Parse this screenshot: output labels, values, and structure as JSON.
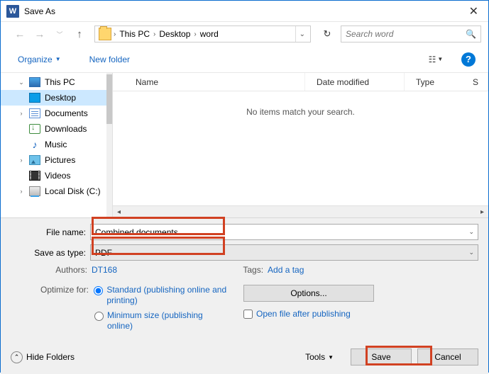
{
  "window": {
    "title": "Save As"
  },
  "path": {
    "root": "This PC",
    "p1": "Desktop",
    "p2": "word"
  },
  "search": {
    "placeholder": "Search word"
  },
  "toolbar": {
    "organize": "Organize",
    "newfolder": "New folder"
  },
  "tree": {
    "pc": "This PC",
    "desktop": "Desktop",
    "documents": "Documents",
    "downloads": "Downloads",
    "music": "Music",
    "pictures": "Pictures",
    "videos": "Videos",
    "localdisk": "Local Disk (C:)"
  },
  "cols": {
    "name": "Name",
    "date": "Date modified",
    "type": "Type",
    "size": "S"
  },
  "empty": "No items match your search.",
  "form": {
    "fname_label": "File name:",
    "fname_value": "Combined documents",
    "type_label": "Save as type:",
    "type_value": "PDF",
    "authors_label": "Authors:",
    "authors_value": "DT168",
    "tags_label": "Tags:",
    "tags_value": "Add a tag",
    "optimize_label": "Optimize for:",
    "radio1": "Standard (publishing online and printing)",
    "radio2": "Minimum size (publishing online)",
    "options_btn": "Options...",
    "openafter": "Open file after publishing"
  },
  "footer": {
    "hide": "Hide Folders",
    "tools": "Tools",
    "save": "Save",
    "cancel": "Cancel"
  }
}
